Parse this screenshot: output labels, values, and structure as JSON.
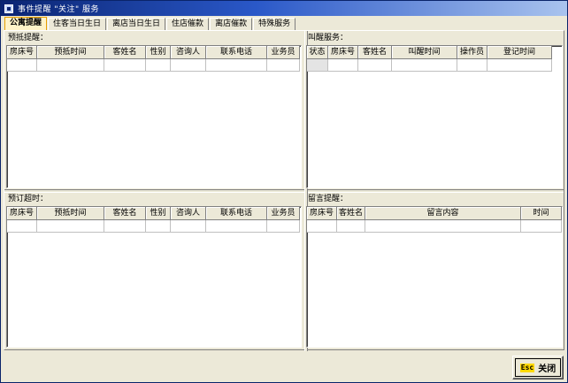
{
  "window": {
    "title": "事件提醒 \"关注\" 服务"
  },
  "tabs": [
    {
      "label": "公寓提醒"
    },
    {
      "label": "住客当日生日"
    },
    {
      "label": "离店当日生日"
    },
    {
      "label": "住店催款"
    },
    {
      "label": "离店催款"
    },
    {
      "label": "特殊服务"
    }
  ],
  "panels": {
    "arrival": {
      "title": "预抵提醒：",
      "columns": [
        "房床号",
        "预抵时间",
        "客姓名",
        "性别",
        "咨询人",
        "联系电话",
        "业务员"
      ]
    },
    "wakeup": {
      "title": "叫醒服务：",
      "columns": [
        "状态",
        "房床号",
        "客姓名",
        "叫醒时间",
        "操作员",
        "登记时间"
      ]
    },
    "reservation": {
      "title": "预订超时：",
      "columns": [
        "房床号",
        "预抵时间",
        "客姓名",
        "性别",
        "咨询人",
        "联系电话",
        "业务员"
      ]
    },
    "message": {
      "title": "留言提醒：",
      "columns": [
        "房床号",
        "客姓名",
        "留言内容",
        "时间"
      ]
    }
  },
  "footer": {
    "close_key": "Esc",
    "close_label": "关闭"
  },
  "colors": {
    "title_dark": "#0a2472",
    "face": "#ece9d8",
    "active_tab": "#fff3c8"
  }
}
